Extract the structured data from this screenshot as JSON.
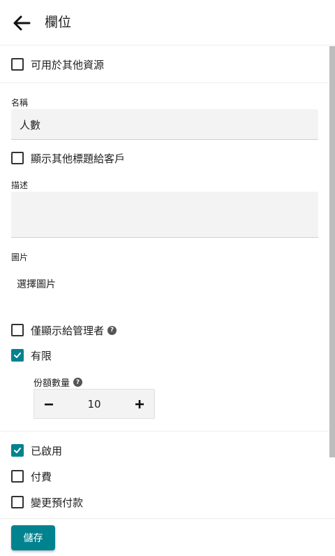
{
  "header": {
    "title": "欄位"
  },
  "checkboxes": {
    "shared": {
      "label": "可用於其他資源",
      "checked": false
    },
    "show_other_title": {
      "label": "顯示其他標題給客戶",
      "checked": false
    },
    "admin_only": {
      "label": "僅顯示給管理者",
      "checked": false
    },
    "limited": {
      "label": "有限",
      "checked": true
    },
    "enabled": {
      "label": "已啟用",
      "checked": true
    },
    "paid": {
      "label": "付費",
      "checked": false
    },
    "change_deposit": {
      "label": "變更預付款",
      "checked": false
    }
  },
  "name_field": {
    "label": "名稱",
    "value": "人數"
  },
  "description_field": {
    "label": "描述",
    "value": ""
  },
  "image_field": {
    "label": "圖片",
    "choose_label": "選擇圖片"
  },
  "quota": {
    "label": "份額數量",
    "value": "10"
  },
  "footer": {
    "save_label": "儲存"
  },
  "colors": {
    "accent": "#00838f"
  }
}
